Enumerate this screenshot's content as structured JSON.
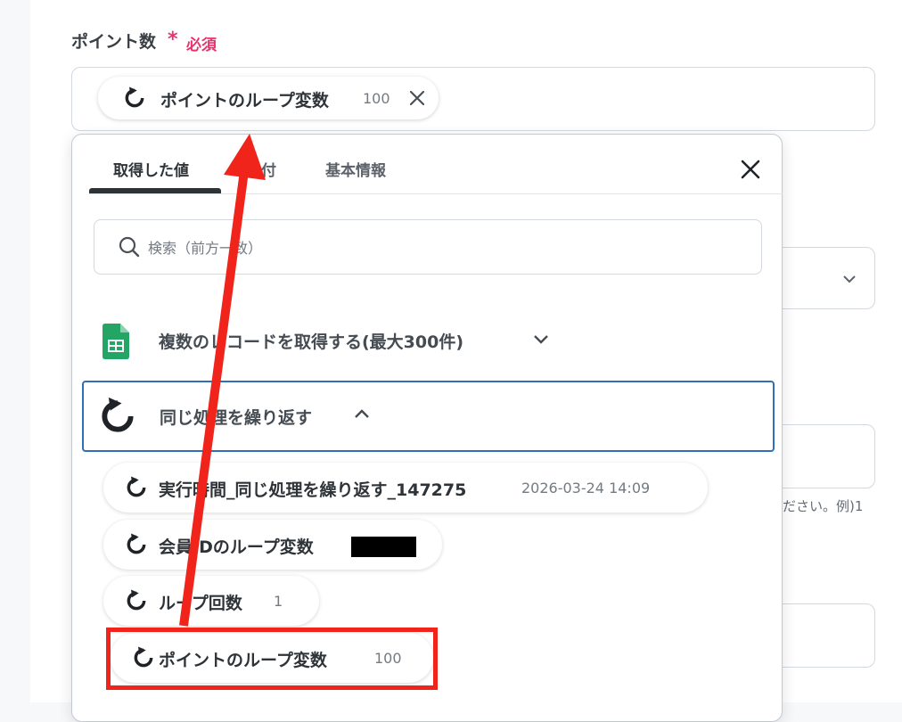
{
  "field": {
    "label": "ポイント数",
    "required_star": "*",
    "required_text": "必須"
  },
  "selected_chip": {
    "label": "ポイントのループ変数",
    "value": "100"
  },
  "background": {
    "hint_text": "ださい。例)1"
  },
  "dropdown": {
    "tabs": [
      {
        "label": "取得した値",
        "active": true
      },
      {
        "label": "付"
      },
      {
        "label": "基本情報"
      }
    ],
    "search": {
      "placeholder": "検索（前方一致）"
    },
    "groups": [
      {
        "label": "複数のレコードを取得する(最大300件)",
        "icon": "google-sheets-icon",
        "expanded": false
      },
      {
        "label": "同じ処理を繰り返す",
        "icon": "loop-icon",
        "expanded": true
      }
    ],
    "items": [
      {
        "label": "実行時間_同じ処理を繰り返す_147275",
        "value": "2026-03-24 14:09"
      },
      {
        "label": "会員IDのループ変数",
        "value": ""
      },
      {
        "label": "ループ回数",
        "value": "1"
      },
      {
        "label": "ポイントのループ変数",
        "value": "100"
      }
    ]
  },
  "colors": {
    "required": "#e8336d",
    "focus_border": "#2f6fb5",
    "annotation_red": "#f0241b",
    "sheets_green": "#23a566"
  }
}
